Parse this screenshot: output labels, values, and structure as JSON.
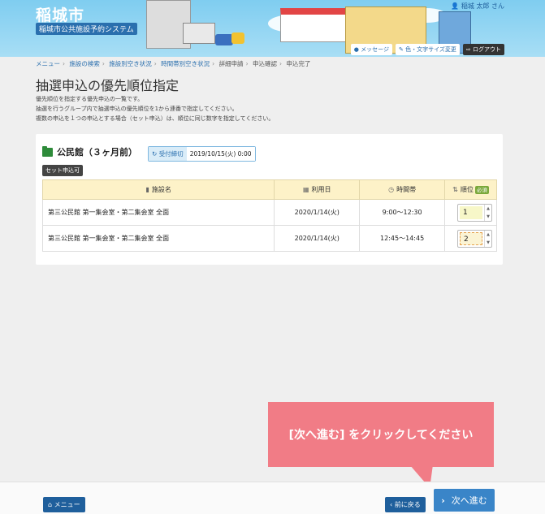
{
  "header": {
    "city_name": "稲城市",
    "system_name": "稲城市公共施設予約システム",
    "user": "稲城 太郎 さん",
    "links": {
      "message": "メッセージ",
      "color_font": "色・文字サイズ変更",
      "logout": "ログアウト"
    }
  },
  "breadcrumb": {
    "items": [
      "メニュー",
      "施設の検索",
      "施設別空き状況",
      "時間帯別空き状況",
      "詳細申請",
      "申込確認",
      "申込完了"
    ]
  },
  "page": {
    "title": "抽選申込の優先順位指定",
    "desc1": "優先順位を指定する優先申込の一覧です。",
    "desc2": "抽選を行うグループ内で抽選申込の優先順位を1から連番で指定してください。",
    "desc3": "複数の申込を１つの申込とする場合（セット申込）は、順位に同じ数字を指定してください。"
  },
  "facility": {
    "name": "公民館（３ヶ月前）",
    "deadline_label": "受付締切",
    "deadline_value": "2019/10/15(火) 0:00",
    "set_badge": "セット申込可"
  },
  "table": {
    "headers": {
      "facility": "施設名",
      "date": "利用日",
      "time": "時間帯",
      "rank": "順位",
      "required": "必須"
    },
    "rows": [
      {
        "facility": "第三公民館 第一集会室・第二集会室 全面",
        "date": "2020/1/14(火)",
        "time": "9:00〜12:30",
        "rank": "1"
      },
      {
        "facility": "第三公民館 第一集会室・第二集会室 全面",
        "date": "2020/1/14(火)",
        "time": "12:45〜14:45",
        "rank": "2"
      }
    ]
  },
  "tooltip": {
    "text": "[次へ進む] をクリックしてください"
  },
  "footer": {
    "menu": "メニュー",
    "back": "前に戻る",
    "next": "次へ進む"
  }
}
